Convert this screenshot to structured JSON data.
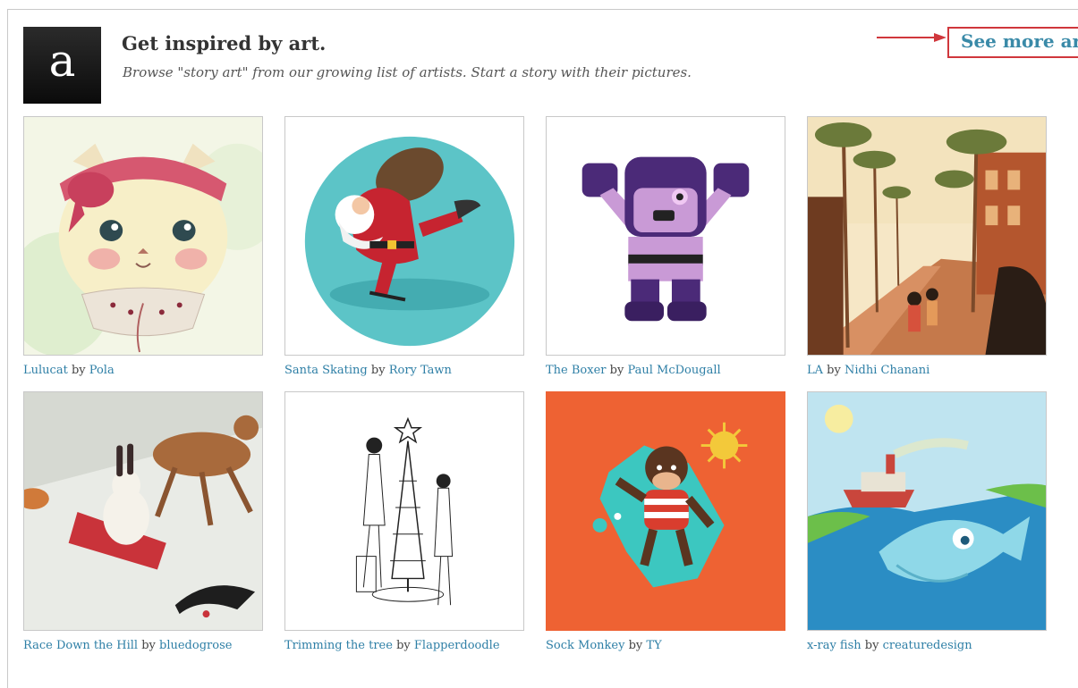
{
  "header": {
    "logo_letter": "a",
    "title": "Get inspired by art.",
    "subtitle": "Browse \"story art\" from our growing list of artists. Start a story with their pictures.",
    "see_more": "See more art"
  },
  "artworks": [
    {
      "title": "Lulucat",
      "by": "by",
      "artist": "Pola"
    },
    {
      "title": "Santa Skating",
      "by": "by",
      "artist": "Rory Tawn"
    },
    {
      "title": "The Boxer",
      "by": "by",
      "artist": "Paul McDougall"
    },
    {
      "title": "LA",
      "by": "by",
      "artist": "Nidhi Chanani"
    },
    {
      "title": "Race Down the Hill",
      "by": "by",
      "artist": "bluedogrose"
    },
    {
      "title": "Trimming the tree",
      "by": "by",
      "artist": "Flapperdoodle"
    },
    {
      "title": "Sock Monkey",
      "by": "by",
      "artist": "TY"
    },
    {
      "title": "x-ray fish",
      "by": "by",
      "artist": "creaturedesign"
    }
  ],
  "colors": {
    "link": "#2e7fa6",
    "see_more": "#3a8aa8",
    "highlight": "#d0373c",
    "sock_monkey_bg": "#ee6233"
  }
}
